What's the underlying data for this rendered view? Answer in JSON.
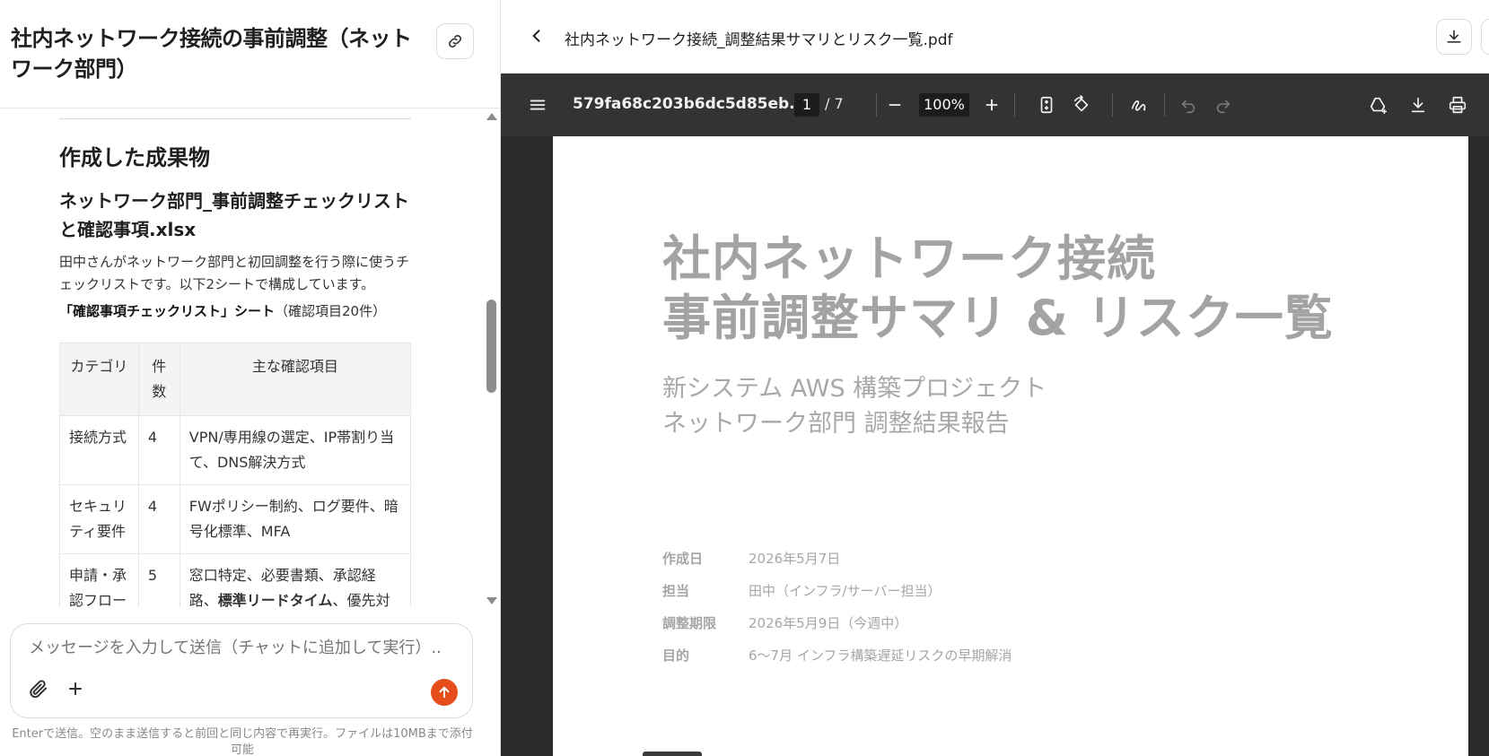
{
  "chat": {
    "title": "社内ネットワーク接続の事前調整（ネットワーク部門）",
    "section_heading": "作成した成果物",
    "file_heading": "ネットワーク部門_事前調整チェックリストと確認事項.xlsx",
    "description": "田中さんがネットワーク部門と初回調整を行う際に使うチェックリストです。以下2シートで構成しています。",
    "sheet_name": "「確認事項チェックリスト」シート",
    "sheet_note": "（確認項目20件）",
    "table": {
      "headers": [
        "カテゴリ",
        "件数",
        "主な確認項目"
      ],
      "rows": [
        {
          "category": "接続方式",
          "count": "4",
          "items_pre": "VPN/専用線の選定、IP帯割り当て、DNS解決方式",
          "items_bold": "",
          "items_post": ""
        },
        {
          "category": "セキュリティ要件",
          "count": "4",
          "items_pre": "FWポリシー制約、ログ要件、暗号化標準、MFA",
          "items_bold": "",
          "items_post": ""
        },
        {
          "category": "申請・承認フロー",
          "count": "5",
          "items_pre": "窓口特定、必要書類、承認経路、",
          "items_bold": "標準リードタイム",
          "items_post": "、優先対応"
        }
      ]
    },
    "composer_placeholder": "メッセージを入力して送信（チャットに追加して実行）...",
    "hint": "Enterで送信。空のまま送信すると前回と同じ内容で再実行。ファイルは10MBまで添付可能"
  },
  "viewer": {
    "file_title": "社内ネットワーク接続_調整結果サマリとリスク一覧.pdf",
    "toolbar": {
      "doc_id": "579fa68c203b6dc5d85eb...",
      "page_current": "1",
      "page_total": "/ 7",
      "zoom": "100%"
    },
    "page": {
      "title_line1": "社内ネットワーク接続",
      "title_line2": "事前調整サマリ & リスク一覧",
      "subtitle_line1": "新システム AWS 構築プロジェクト",
      "subtitle_line2": "ネットワーク部門 調整結果報告",
      "meta": [
        {
          "key": "作成日",
          "value": "2026年5月7日"
        },
        {
          "key": "担当",
          "value": "田中（インフラ/サーバー担当）"
        },
        {
          "key": "調整期限",
          "value": "2026年5月9日（今週中）"
        },
        {
          "key": "目的",
          "value": "6〜7月 インフラ構築遅延リスクの早期解消"
        }
      ]
    }
  },
  "colors": {
    "send_button": "#e54d1a",
    "toolbar_bg": "#333333",
    "viewer_bg": "#2b2b2b",
    "pdf_text": "#a3a3a3"
  },
  "icons": [
    "link-icon",
    "paperclip-icon",
    "plus-icon",
    "arrow-up-icon",
    "chevron-left-icon",
    "download-icon",
    "hamburger-icon",
    "minus-icon",
    "fit-page-icon",
    "rotate-icon",
    "draw-icon",
    "undo-icon",
    "redo-icon",
    "add-drive-icon",
    "print-icon"
  ]
}
